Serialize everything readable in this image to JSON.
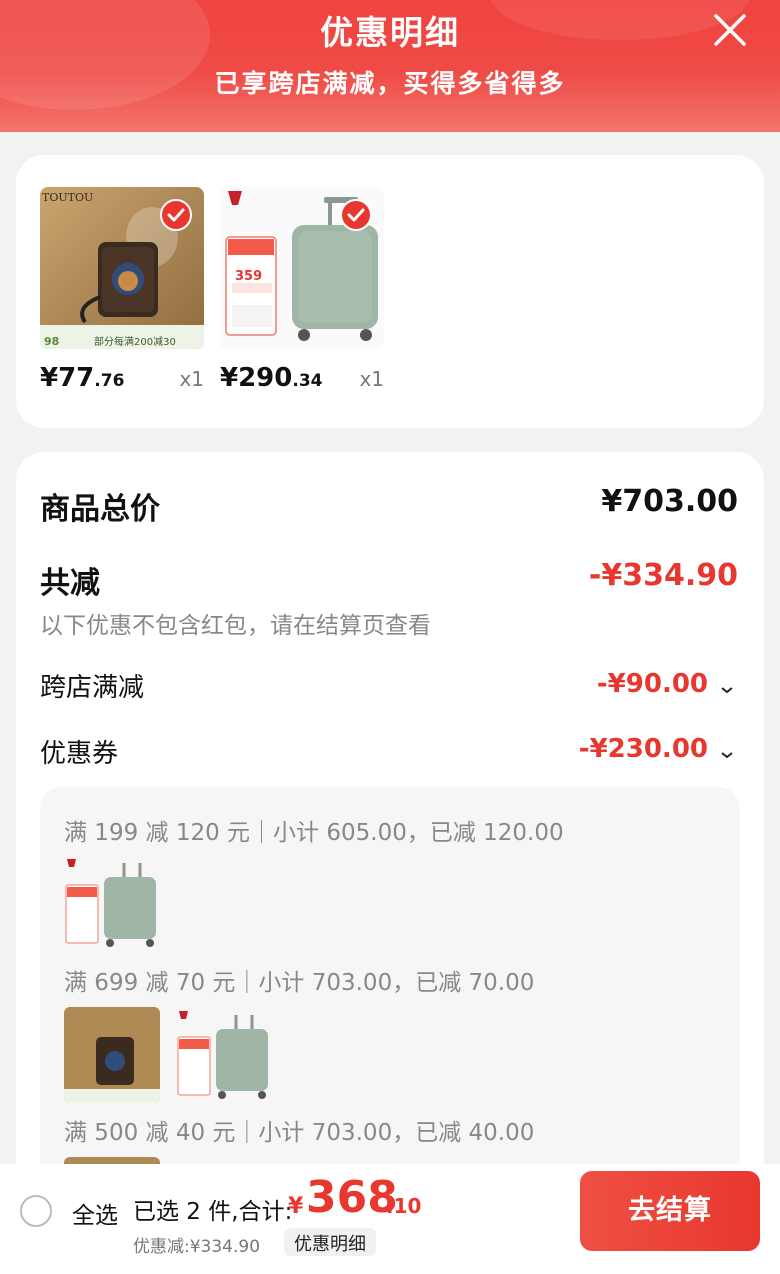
{
  "header": {
    "title": "优惠明细",
    "subtitle": "已享跨店满减，买得多省得多"
  },
  "products": [
    {
      "price_int": "¥77",
      "price_dec": ".76",
      "qty": "x1",
      "image": "wallet-bag-product",
      "thumb_text": "TOUTOU",
      "banner": "部分每满200减30",
      "badge": "98"
    },
    {
      "price_int": "¥290",
      "price_dec": ".34",
      "qty": "x1",
      "image": "green-suitcase-product",
      "thumb_text": "359"
    }
  ],
  "summary": {
    "total_label": "商品总价",
    "total_value": "¥703.00",
    "reduce_label": "共减",
    "reduce_value": "-¥334.90",
    "reduce_note": "以下优惠不包含红包，请在结算页查看",
    "cross_store_label": "跨店满减",
    "cross_store_value": "-¥90.00",
    "coupon_label": "优惠券",
    "coupon_value": "-¥230.00"
  },
  "coupon_tiers": [
    {
      "text": "满 199 减 120 元｜小计 605.00，已减 120.00"
    },
    {
      "text": "满 699 减 70 元｜小计 703.00，已减 70.00"
    },
    {
      "text": "满 500 减 40 元｜小计 703.00，已减 40.00"
    }
  ],
  "bottom_bar": {
    "select_all": "全选",
    "selected_text": "已选 2 件,合计:",
    "currency": "¥",
    "total_int": "368",
    "total_dec": ".10",
    "discount_text": "优惠减:¥334.90",
    "detail_label": "优惠明细",
    "checkout_label": "去结算"
  },
  "colors": {
    "accent": "#e8372f",
    "header_red": "#f0433f",
    "suitcase_green": "#9fb5a5"
  }
}
